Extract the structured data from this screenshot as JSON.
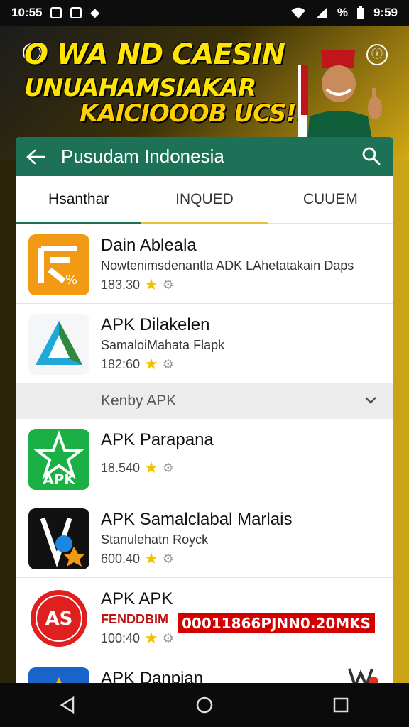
{
  "status_bar": {
    "time_left": "10:55",
    "time_right": "9:59",
    "left_icons": [
      "gallery-icon",
      "square-icon",
      "diamond-icon"
    ],
    "right_icons": [
      "wifi-icon",
      "signal-icon",
      "battery-icon"
    ]
  },
  "banner": {
    "line1": "O WA ND CAESIN",
    "line2": "UNUAHAMSIAKAR",
    "line3": "KAICIOOOB UCS!!"
  },
  "header": {
    "title": "Pusudam Indonesia"
  },
  "tabs": [
    {
      "label": "Hsanthar",
      "active": true
    },
    {
      "label": "INQUED",
      "active": false
    },
    {
      "label": "CUUEM",
      "active": false
    }
  ],
  "apps": [
    {
      "name": "Dain Ableala",
      "subtitle": "Nowtenimsdenantla ADK LAhetatakain Daps",
      "rating": "183.30",
      "icon": "apk-orange-icon"
    },
    {
      "name": "APK Dilakelen",
      "subtitle": "SamaloiMahata Flapk",
      "rating": "182:60",
      "icon": "apk-blue-triangle-icon"
    }
  ],
  "section": {
    "label": "Kenby  APK"
  },
  "apps2": [
    {
      "name": "APK Parapana",
      "subtitle": "",
      "rating": "18.540",
      "icon": "apk-green-star-icon",
      "icon_text": "APK"
    },
    {
      "name": "APK Samalclabal Marlais",
      "subtitle": "Stanulehatn Royck",
      "rating": "600.40",
      "icon": "apk-black-icon"
    },
    {
      "name": "APK APK",
      "subtitle": "FENDDBIM",
      "rating": "100:40",
      "icon": "apk-red-circle-icon",
      "icon_text": "AS"
    },
    {
      "name": "APK Danpian",
      "subtitle": "",
      "rating": "",
      "icon": "apk-blue-icon"
    }
  ],
  "promo_text": "00011866PJNN0.20MKS",
  "colors": {
    "accent_green": "#1c7157",
    "tab_indicator_active": "#1c7157",
    "tab_indicator_gold": "#e8c13a",
    "star": "#f3c000",
    "banner_text": "#ffe500"
  }
}
